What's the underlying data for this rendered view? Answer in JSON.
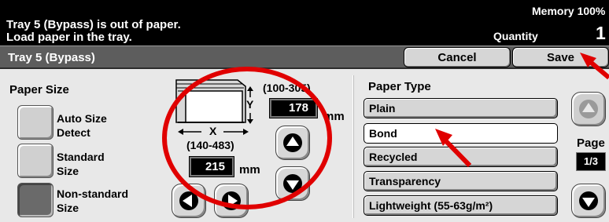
{
  "status": {
    "message_line1": "Tray 5 (Bypass) is out of paper.",
    "message_line2": "Load paper in the tray.",
    "memory_label": "Memory 100%",
    "quantity_label": "Quantity",
    "quantity_value": "1"
  },
  "header": {
    "title": "Tray 5 (Bypass)",
    "cancel_label": "Cancel",
    "save_label": "Save"
  },
  "paper_size": {
    "label": "Paper Size",
    "options": [
      {
        "label_line1": "Auto Size",
        "label_line2": "Detect",
        "selected": false
      },
      {
        "label_line1": "Standard",
        "label_line2": "Size",
        "selected": false
      },
      {
        "label_line1": "Non-standard",
        "label_line2": "Size",
        "selected": true
      }
    ],
    "y_range": "(100-305)",
    "y_value": "178",
    "y_axis_letter": "Y",
    "x_range": "(140-483)",
    "x_value": "215",
    "x_axis_letter": "X",
    "unit": "mm"
  },
  "paper_type": {
    "label": "Paper Type",
    "options": [
      "Plain",
      "Bond",
      "Recycled",
      "Transparency",
      "Lightweight (55-63g/m²)"
    ],
    "selected_index": 1
  },
  "pager": {
    "label": "Page",
    "value": "1/3"
  },
  "colors": {
    "annotation_red": "#e00000",
    "status_bar": "#000000",
    "title_bar": "#5d5d5d"
  },
  "icons": [
    "up-arrow-icon",
    "down-arrow-icon",
    "left-arrow-icon",
    "right-arrow-icon",
    "paper-diagram-icon"
  ]
}
